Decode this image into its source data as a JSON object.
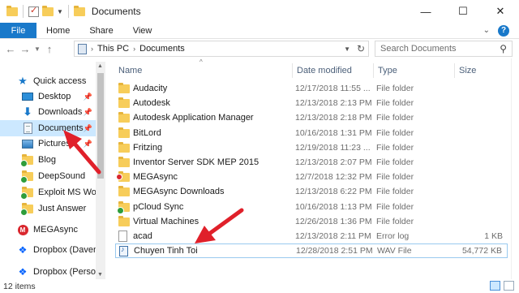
{
  "window": {
    "title": "Documents",
    "controls": {
      "minimize": "—",
      "maximize": "☐",
      "close": "✕"
    }
  },
  "ribbon": {
    "file_tab": "File",
    "tabs": [
      "Home",
      "Share",
      "View"
    ]
  },
  "address": {
    "crumbs": [
      "This PC",
      "Documents"
    ],
    "search_placeholder": "Search Documents"
  },
  "sidebar": {
    "items": [
      {
        "label": "Quick access",
        "icon": "star-icon"
      },
      {
        "label": "Desktop",
        "icon": "desktop-icon",
        "pinned": true
      },
      {
        "label": "Downloads",
        "icon": "download-icon",
        "pinned": true
      },
      {
        "label": "Documents",
        "icon": "documents-icon",
        "pinned": true,
        "selected": true
      },
      {
        "label": "Pictures",
        "icon": "pictures-icon",
        "pinned": true
      },
      {
        "label": "Blog",
        "icon": "folder-icon"
      },
      {
        "label": "DeepSound",
        "icon": "folder-icon"
      },
      {
        "label": "Exploit MS Word",
        "icon": "folder-icon"
      },
      {
        "label": "Just Answer",
        "icon": "folder-icon"
      },
      {
        "label": "MEGAsync",
        "icon": "mega-icon"
      },
      {
        "label": "Dropbox (Davenp",
        "icon": "dropbox-icon"
      },
      {
        "label": "Dropbox (Persona",
        "icon": "dropbox-icon"
      }
    ]
  },
  "columns": {
    "name": "Name",
    "date": "Date modified",
    "type": "Type",
    "size": "Size"
  },
  "files": [
    {
      "name": "Audacity",
      "date": "12/17/2018 11:55 ...",
      "type": "File folder",
      "size": "",
      "icon": "folder-icon"
    },
    {
      "name": "Autodesk",
      "date": "12/13/2018 2:13 PM",
      "type": "File folder",
      "size": "",
      "icon": "folder-icon"
    },
    {
      "name": "Autodesk Application Manager",
      "date": "12/13/2018 2:18 PM",
      "type": "File folder",
      "size": "",
      "icon": "folder-icon"
    },
    {
      "name": "BitLord",
      "date": "10/16/2018 1:31 PM",
      "type": "File folder",
      "size": "",
      "icon": "folder-icon"
    },
    {
      "name": "Fritzing",
      "date": "12/19/2018 11:23 ...",
      "type": "File folder",
      "size": "",
      "icon": "folder-icon"
    },
    {
      "name": "Inventor Server SDK MEP 2015",
      "date": "12/13/2018 2:07 PM",
      "type": "File folder",
      "size": "",
      "icon": "folder-icon"
    },
    {
      "name": "MEGAsync",
      "date": "12/7/2018 12:32 PM",
      "type": "File folder",
      "size": "",
      "icon": "mega-folder-icon"
    },
    {
      "name": "MEGAsync Downloads",
      "date": "12/13/2018 6:22 PM",
      "type": "File folder",
      "size": "",
      "icon": "folder-icon"
    },
    {
      "name": "pCloud Sync",
      "date": "10/16/2018 1:13 PM",
      "type": "File folder",
      "size": "",
      "icon": "sync-folder-icon"
    },
    {
      "name": "Virtual Machines",
      "date": "12/26/2018 1:36 PM",
      "type": "File folder",
      "size": "",
      "icon": "folder-icon"
    },
    {
      "name": "acad",
      "date": "12/13/2018 2:11 PM",
      "type": "Error log",
      "size": "1 KB",
      "icon": "file-icon"
    },
    {
      "name": "Chuyen Tinh Toi",
      "date": "12/28/2018 2:51 PM",
      "type": "WAV File",
      "size": "54,772 KB",
      "icon": "wav-file-icon"
    }
  ],
  "status": {
    "item_count": "12 items"
  },
  "colors": {
    "accent": "#1979ca",
    "selected": "#cce8ff",
    "folder": "#f7cd5a",
    "annotation": "#e0202a"
  }
}
